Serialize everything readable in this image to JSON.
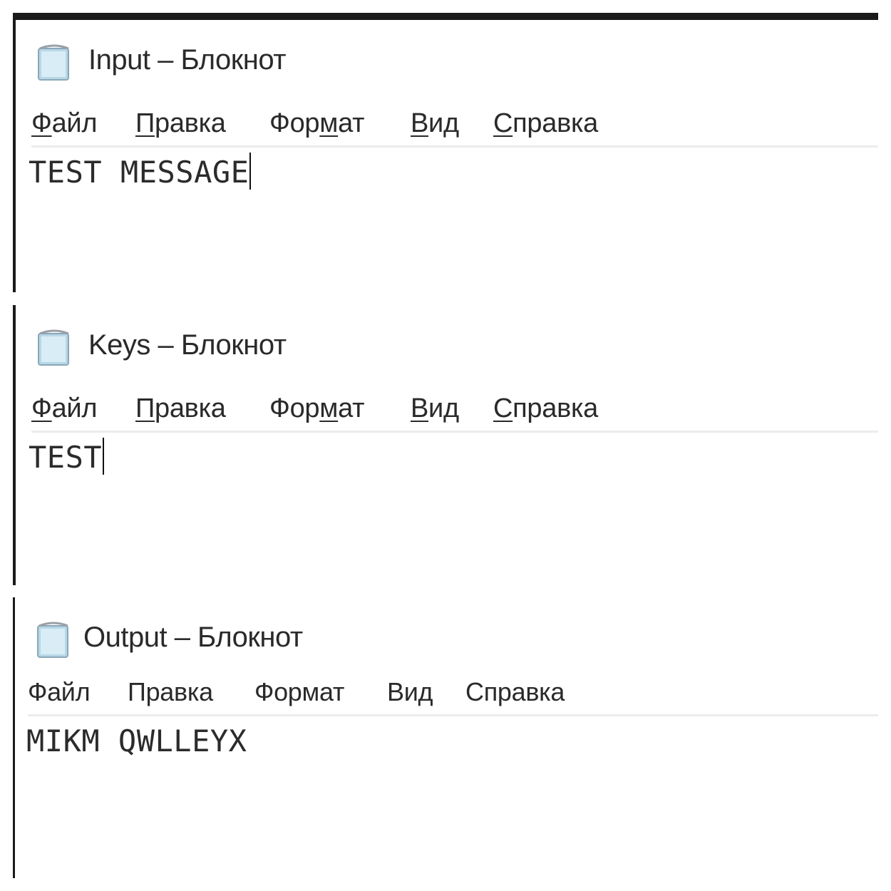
{
  "windows": [
    {
      "title": "Input – Блокнот",
      "icon": "notepad-icon",
      "menu": [
        {
          "hotkey": "Ф",
          "rest": "айл"
        },
        {
          "hotkey": "П",
          "rest": "равка"
        },
        {
          "pre": "Фор",
          "hotkey": "м",
          "rest": "ат"
        },
        {
          "hotkey": "В",
          "rest": "ид"
        },
        {
          "hotkey": "С",
          "rest": "правка"
        }
      ],
      "content": "TEST MESSAGE",
      "caret_visible": true
    },
    {
      "title": "Keys – Блокнот",
      "icon": "notepad-icon",
      "menu": [
        {
          "hotkey": "Ф",
          "rest": "айл"
        },
        {
          "hotkey": "П",
          "rest": "равка"
        },
        {
          "pre": "Фор",
          "hotkey": "м",
          "rest": "ат"
        },
        {
          "hotkey": "В",
          "rest": "ид"
        },
        {
          "hotkey": "С",
          "rest": "правка"
        }
      ],
      "content": "TEST",
      "caret_visible": true
    },
    {
      "title": "Output – Блокнот",
      "icon": "notepad-icon",
      "menu": [
        "Файл",
        "Правка",
        "Формат",
        "Вид",
        "Справка"
      ],
      "content": "MIKM QWLLEYX",
      "caret_visible": false
    }
  ],
  "colors": {
    "frame": "#1a1a1a",
    "menu_border": "#ececec",
    "text": "#2a2a2a"
  }
}
